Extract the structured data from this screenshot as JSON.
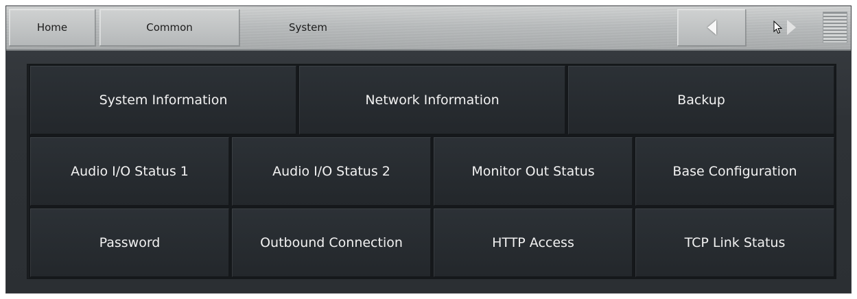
{
  "header": {
    "home_label": "Home",
    "common_label": "Common",
    "current_label": "System"
  },
  "rows": [
    [
      "System Information",
      "Network Information",
      "Backup"
    ],
    [
      "Audio I/O Status 1",
      "Audio I/O Status 2",
      "Monitor Out Status",
      "Base Configuration"
    ],
    [
      "Password",
      "Outbound Connection",
      "HTTP Access",
      "TCP Link Status"
    ]
  ],
  "icons": {
    "back": "triangle-left-icon",
    "forward": "triangle-right-icon",
    "cursor": "mouse-pointer-icon",
    "menu": "hamburger-menu-icon"
  },
  "colors": {
    "header_bg": "#bfc2c3",
    "panel_bg": "#2e3236",
    "tile_bg": "#282c30",
    "tile_text": "#f2f2f2"
  }
}
